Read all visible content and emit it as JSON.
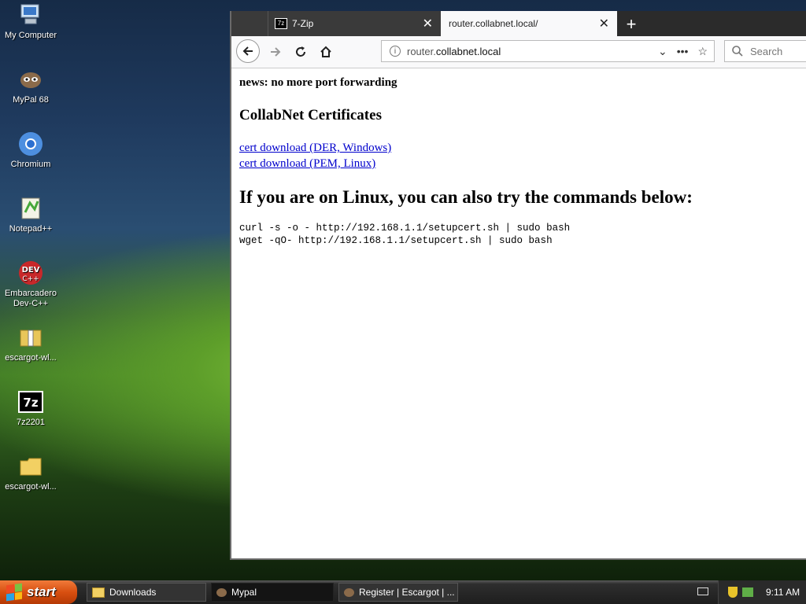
{
  "desktop": {
    "icons": [
      {
        "label": "My Computer"
      },
      {
        "label": "MyPal 68"
      },
      {
        "label": "Chromium"
      },
      {
        "label": "Notepad++"
      },
      {
        "label": "Embarcadero Dev-C++"
      },
      {
        "label": "escargot-wl..."
      },
      {
        "label": "7z2201"
      },
      {
        "label": "escargot-wl..."
      }
    ]
  },
  "browser": {
    "tabs": [
      {
        "label": "7-Zip"
      },
      {
        "label": "router.collabnet.local/"
      }
    ],
    "url_prefix": "router.",
    "url_host": "collabnet.local",
    "search_placeholder": "Search",
    "page": {
      "news": "news: no more port forwarding",
      "cert_heading": "CollabNet Certificates",
      "links": [
        "cert download (DER, Windows)",
        "cert download (PEM, Linux)"
      ],
      "linux_heading": "If you are on Linux, you can also try the commands below:",
      "commands": [
        "curl -s -o - http://192.168.1.1/setupcert.sh | sudo bash",
        "wget -qO- http://192.168.1.1/setupcert.sh | sudo bash"
      ]
    }
  },
  "taskbar": {
    "start_label": "start",
    "tasks": [
      {
        "label": "Downloads"
      },
      {
        "label": "Mypal"
      },
      {
        "label": "Register | Escargot | ..."
      }
    ],
    "clock": "9:11 AM"
  }
}
